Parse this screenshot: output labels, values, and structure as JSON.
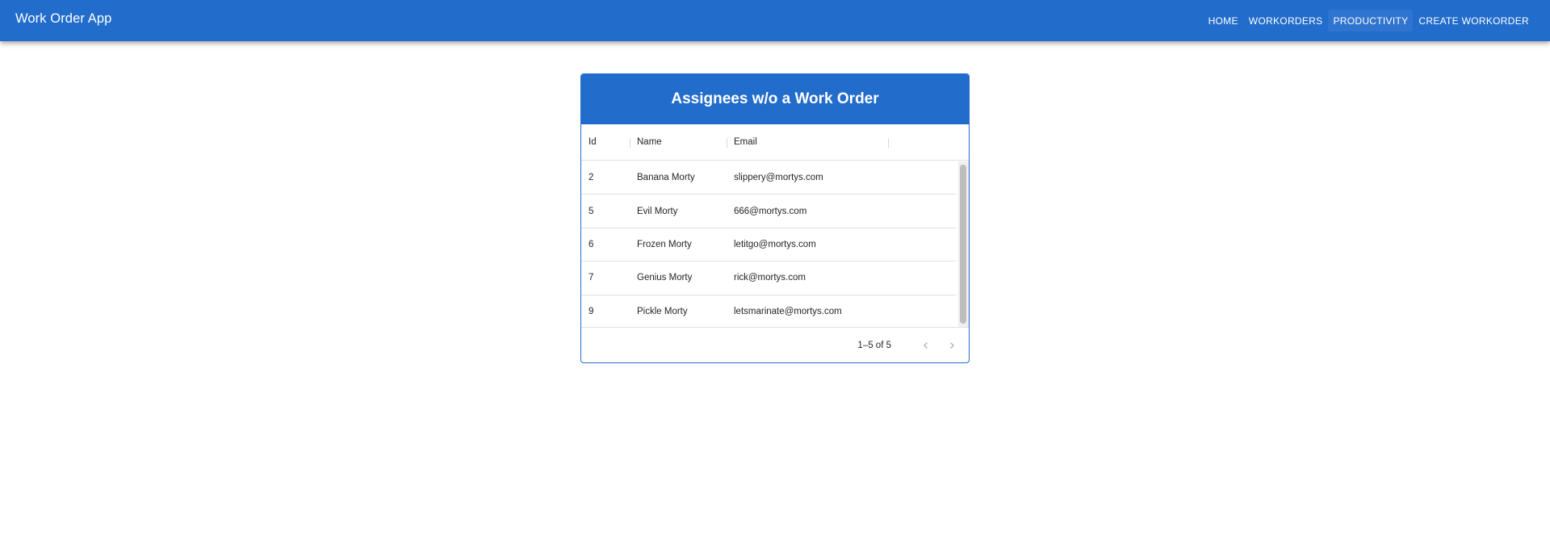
{
  "app": {
    "title": "Work Order App"
  },
  "nav": {
    "home": "HOME",
    "workorders": "WORKORDERS",
    "productivity": "PRODUCTIVITY",
    "create": "CREATE WORKORDER"
  },
  "card": {
    "title": "Assignees w/o a Work Order"
  },
  "table": {
    "columns": {
      "id": "Id",
      "name": "Name",
      "email": "Email"
    },
    "rows": [
      {
        "id": "2",
        "name": "Banana Morty",
        "email": "slippery@mortys.com"
      },
      {
        "id": "5",
        "name": "Evil Morty",
        "email": "666@mortys.com"
      },
      {
        "id": "6",
        "name": "Frozen Morty",
        "email": "letitgo@mortys.com"
      },
      {
        "id": "7",
        "name": "Genius Morty",
        "email": "rick@mortys.com"
      },
      {
        "id": "9",
        "name": "Pickle Morty",
        "email": "letsmarinate@mortys.com"
      }
    ],
    "pagination": "1–5 of 5"
  },
  "icons": {
    "prev": "chevron-left-icon",
    "next": "chevron-right-icon"
  },
  "colors": {
    "primary": "#226ccb"
  }
}
